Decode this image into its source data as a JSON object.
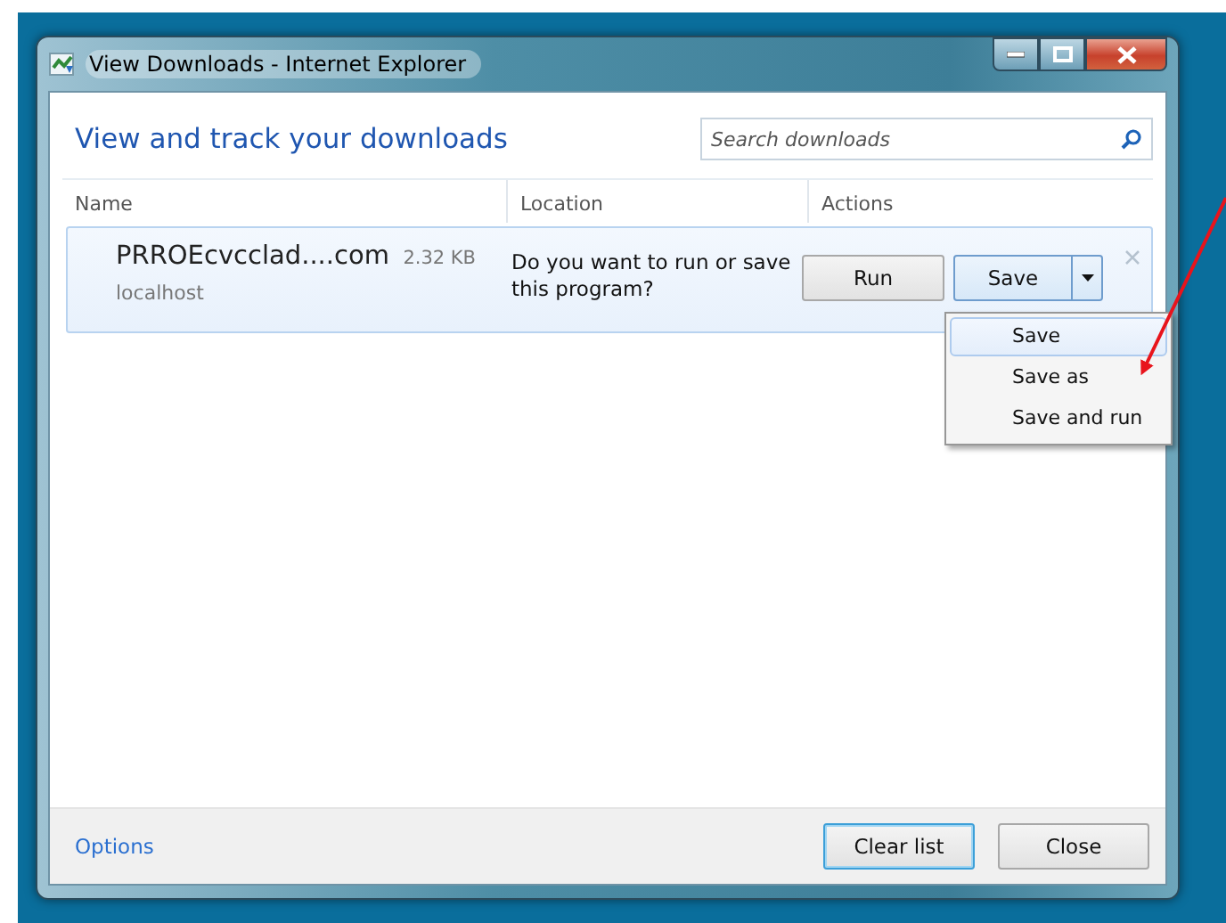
{
  "window": {
    "title": "View Downloads - Internet Explorer"
  },
  "heading": "View and track your downloads",
  "search": {
    "placeholder": "Search downloads"
  },
  "columns": [
    "Name",
    "Location",
    "Actions"
  ],
  "downloads": [
    {
      "name": "PRROEcvcclad....com",
      "size": "2.32 KB",
      "source": "localhost",
      "message": "Do you want to run or save this program?",
      "run_button": "Run",
      "save_button": "Save",
      "selected": true
    }
  ],
  "save_menu": {
    "items": [
      {
        "label": "Save",
        "selected": true
      },
      {
        "label": "Save as",
        "selected": false
      },
      {
        "label": "Save and run",
        "selected": false
      }
    ]
  },
  "footer": {
    "options_link": "Options",
    "buttons": [
      {
        "label": "Clear list",
        "focused": true
      },
      {
        "label": "Close",
        "focused": false
      }
    ]
  }
}
